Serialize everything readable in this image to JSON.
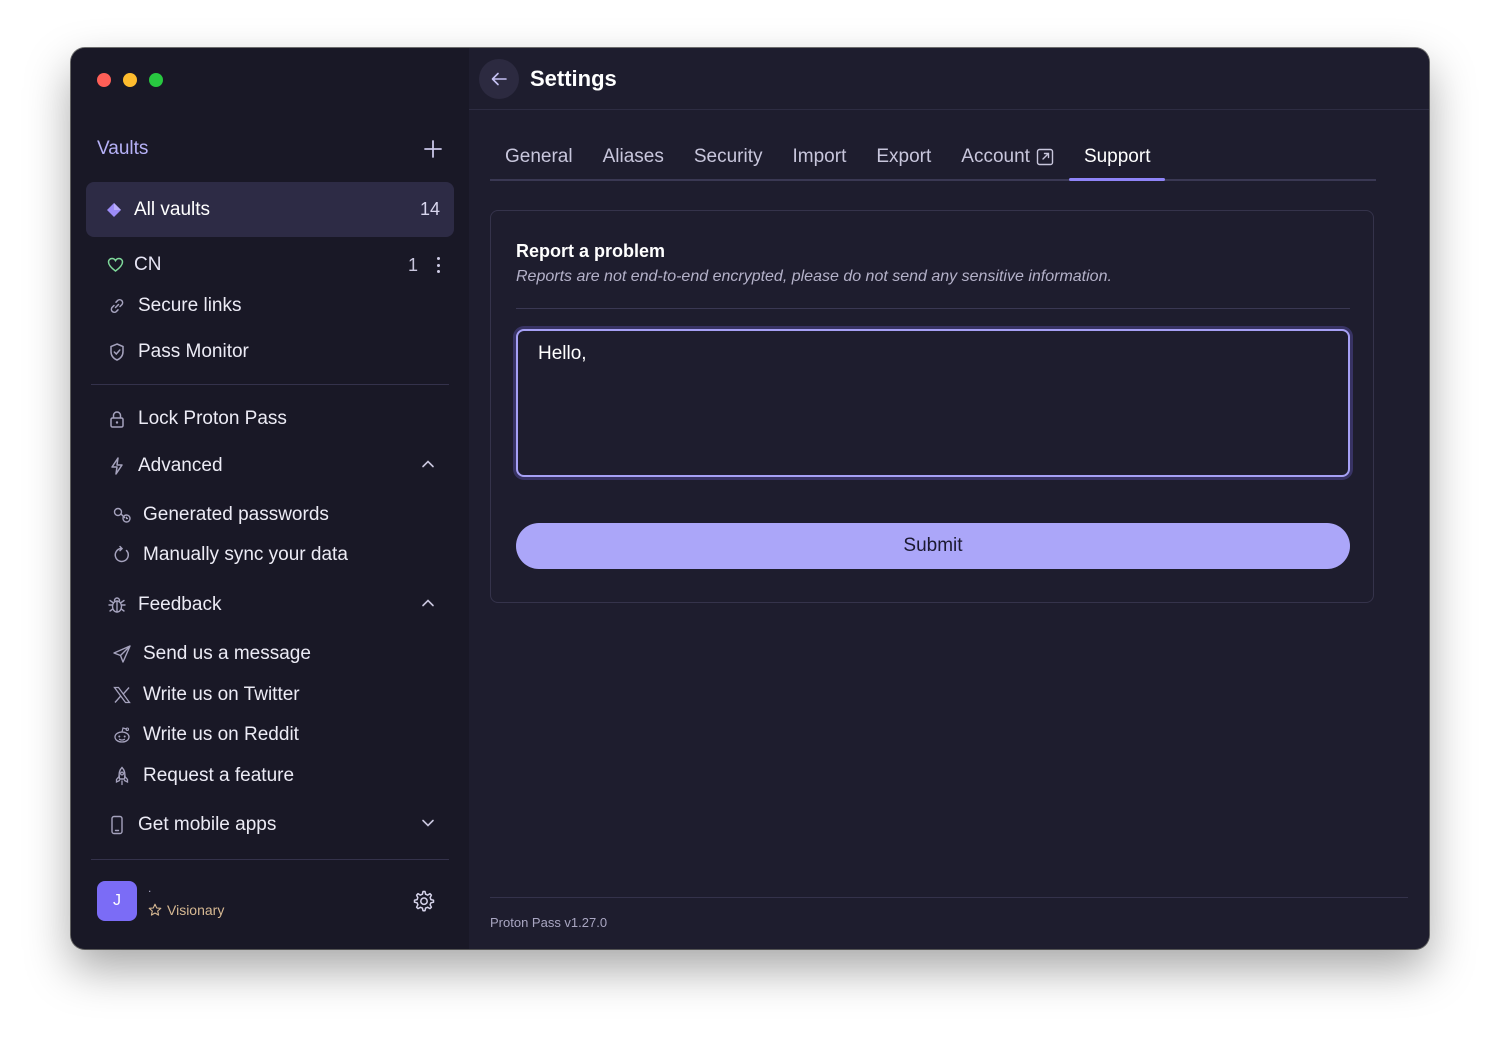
{
  "sidebar": {
    "vaults_title": "Vaults",
    "selected_vault": {
      "label": "All vaults",
      "count": "14"
    },
    "vault_row": {
      "label": "CN",
      "count": "1"
    },
    "items": {
      "secure_links": "Secure links",
      "pass_monitor": "Pass Monitor",
      "lock": "Lock Proton Pass",
      "advanced": "Advanced",
      "generated_passwords": "Generated passwords",
      "manual_sync": "Manually sync your data",
      "feedback": "Feedback",
      "send_message": "Send us a message",
      "twitter": "Write us on Twitter",
      "reddit": "Write us on Reddit",
      "request_feature": "Request a feature",
      "mobile_apps": "Get mobile apps"
    },
    "user": {
      "initial": "J",
      "name": ".",
      "plan": "Visionary"
    }
  },
  "header": {
    "title": "Settings"
  },
  "tabs": [
    {
      "label": "General"
    },
    {
      "label": "Aliases"
    },
    {
      "label": "Security"
    },
    {
      "label": "Import"
    },
    {
      "label": "Export"
    },
    {
      "label": "Account"
    },
    {
      "label": "Support"
    }
  ],
  "support": {
    "title": "Report a problem",
    "note": "Reports are not end-to-end encrypted, please do not send any sensitive information.",
    "message_value": "Hello, ",
    "submit_label": "Submit"
  },
  "footer": {
    "version": "Proton Pass v1.27.0"
  },
  "colors": {
    "accent": "#8f84f8",
    "button": "#aba6f9",
    "sidebar_bg": "#191826",
    "main_bg": "#1e1d2e"
  },
  "icons": {
    "all_vaults": "diamond-icon",
    "cn_vault": "heart-icon",
    "secure_links": "link-icon",
    "pass_monitor": "shield-check-icon",
    "lock": "lock-icon",
    "advanced": "bolt-icon",
    "generated_passwords": "key-history-icon",
    "manual_sync": "refresh-icon",
    "feedback": "bug-icon",
    "send_message": "paper-plane-icon",
    "twitter": "x-logo-icon",
    "reddit": "reddit-icon",
    "request_feature": "rocket-icon",
    "mobile_apps": "mobile-icon"
  }
}
